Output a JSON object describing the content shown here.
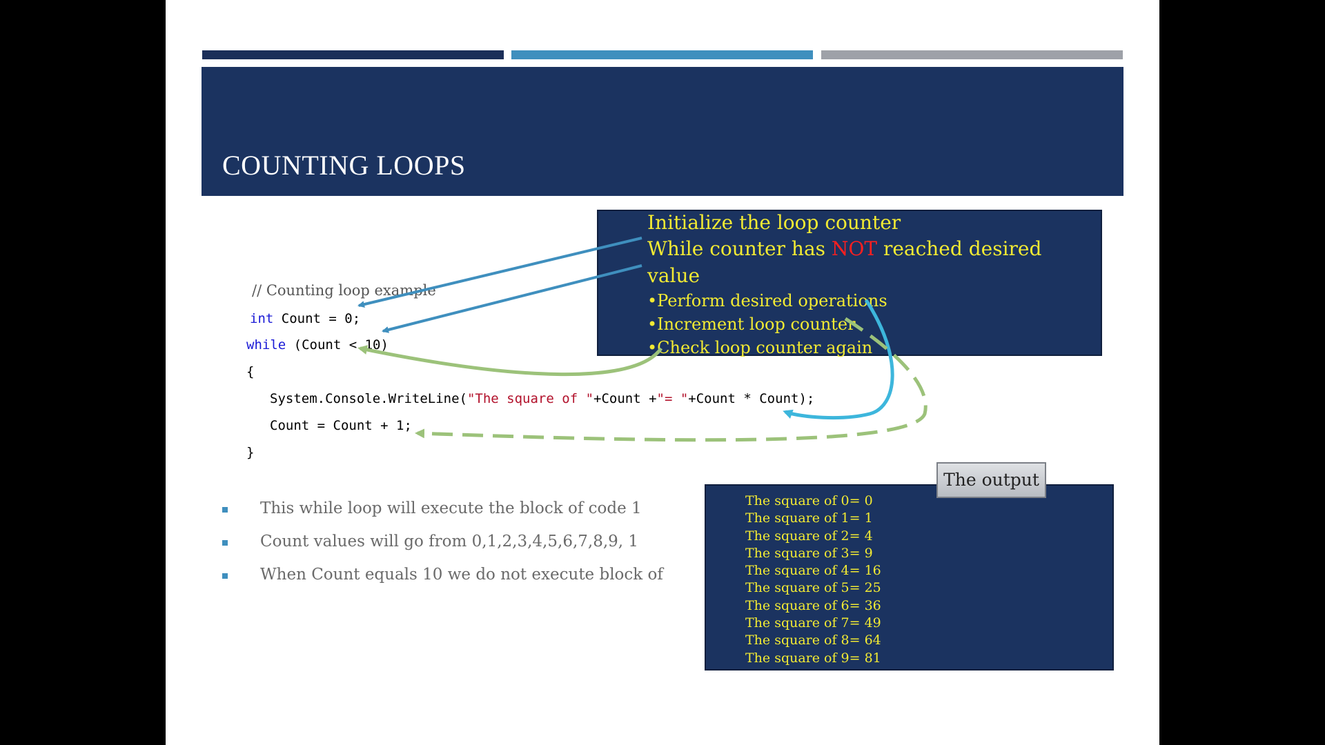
{
  "slide": {
    "title": "COUNTING LOOPS"
  },
  "code": {
    "comment": "// Counting loop example",
    "line2_kw": "int",
    "line2_rest": " Count = 0;",
    "line3_kw": "while",
    "line3_rest": " (Count < 10)",
    "line4": "{",
    "line5_a": "System.Console.WriteLine(",
    "line5_str1": "\"The square of \"",
    "line5_b": "+Count +",
    "line5_str2": "\"= \"",
    "line5_c": "+Count * Count);",
    "line6": "Count = Count + 1;",
    "line7": "}"
  },
  "notes": {
    "line1": "Initialize the loop counter",
    "line2_a": "While counter has ",
    "line2_red": "NOT",
    "line2_b": " reached desired",
    "line3": "value",
    "item1": "•Perform desired operations",
    "item2": "•Increment loop counter",
    "item3": "•Check loop counter again"
  },
  "bullets": [
    "This while loop will execute the block of code 1",
    "Count values will go from 0,1,2,3,4,5,6,7,8,9,  1",
    "When Count equals 10 we do not execute block of"
  ],
  "output": {
    "label": "The output",
    "lines": [
      "The square of 0= 0",
      "The square of 1= 1",
      "The square of 2= 4",
      "The square of 3= 9",
      "The square of 4= 16",
      "The square of 5= 25",
      "The square of 6= 36",
      "The square of 7= 49",
      "The square of 8= 64",
      "The square of 9= 81"
    ]
  },
  "colors": {
    "title_band": "#1b3360",
    "note_text": "#f2ea33",
    "accent_blue": "#3f8fbe",
    "accent_green": "#9cc27a",
    "keyword": "#1a1ad6",
    "string": "#b2112b"
  }
}
